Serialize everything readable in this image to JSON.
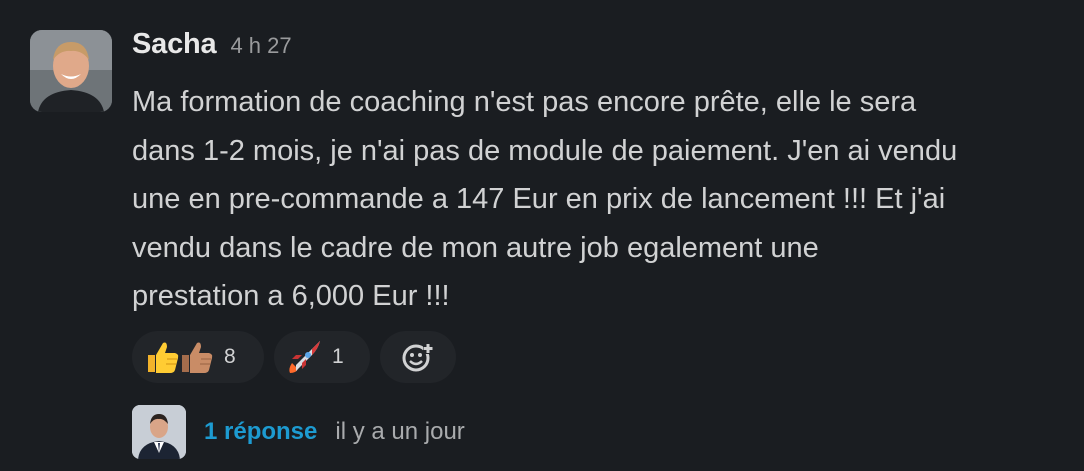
{
  "message": {
    "author": "Sacha",
    "timestamp": "4 h 27",
    "lines": [
      "Ma formation de coaching n'est pas encore prête, elle le sera",
      "dans 1-2 mois, je n'ai pas de module de paiement. J'en ai vendu",
      "une en pre-commande a 147 Eur en prix de lancement !!! Et j'ai",
      "vendu dans le cadre de mon autre job egalement une",
      "prestation a 6,000 Eur !!!"
    ]
  },
  "reactions": [
    {
      "emoji": "thumbs-up (yellow + medium skin tone)",
      "count": "8"
    },
    {
      "emoji": "rocket",
      "count": "1"
    }
  ],
  "add_reaction_icon": "add-emoji-icon",
  "thread": {
    "reply_count": "1 réponse",
    "last_reply": "il y a un jour"
  },
  "colors": {
    "background": "#1a1d21",
    "link": "#1d9bd1",
    "reaction_pill": "#222529"
  }
}
